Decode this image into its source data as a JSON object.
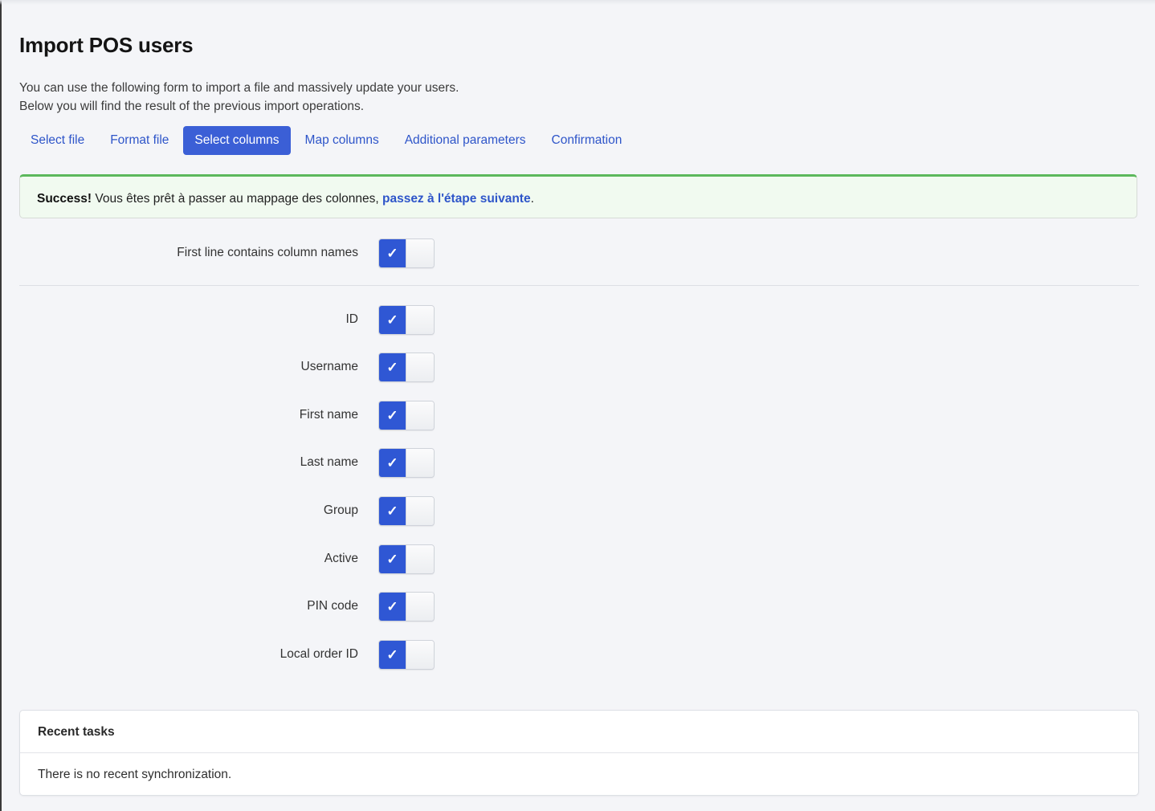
{
  "page": {
    "title": "Import POS users",
    "intro_line_1": "You can use the following form to import a file and massively update your users.",
    "intro_line_2": "Below you will find the result of the previous import operations."
  },
  "tabs": [
    {
      "label": "Select file",
      "active": false
    },
    {
      "label": "Format file",
      "active": false
    },
    {
      "label": "Select columns",
      "active": true
    },
    {
      "label": "Map columns",
      "active": false
    },
    {
      "label": "Additional parameters",
      "active": false
    },
    {
      "label": "Confirmation",
      "active": false
    }
  ],
  "alert": {
    "strong": "Success!",
    "text": " Vous êtes prêt à passer au mappage des colonnes, ",
    "link": "passez à l'étape suivante",
    "end": ".",
    "color": "#5cb85c"
  },
  "first_line_option": {
    "label": "First line contains column names",
    "checked": true,
    "check_glyph": "✓"
  },
  "columns": [
    {
      "label": "ID",
      "checked": true,
      "check_glyph": "✓"
    },
    {
      "label": "Username",
      "checked": true,
      "check_glyph": "✓"
    },
    {
      "label": "First name",
      "checked": true,
      "check_glyph": "✓"
    },
    {
      "label": "Last name",
      "checked": true,
      "check_glyph": "✓"
    },
    {
      "label": "Group",
      "checked": true,
      "check_glyph": "✓"
    },
    {
      "label": "Active",
      "checked": true,
      "check_glyph": "✓"
    },
    {
      "label": "PIN code",
      "checked": true,
      "check_glyph": "✓"
    },
    {
      "label": "Local order ID",
      "checked": true,
      "check_glyph": "✓"
    }
  ],
  "recent_tasks": {
    "title": "Recent tasks",
    "empty_text": "There is no recent synchronization."
  },
  "colors": {
    "accent": "#3b5fd6",
    "link": "#2e55c9",
    "background": "#f4f5f8"
  }
}
